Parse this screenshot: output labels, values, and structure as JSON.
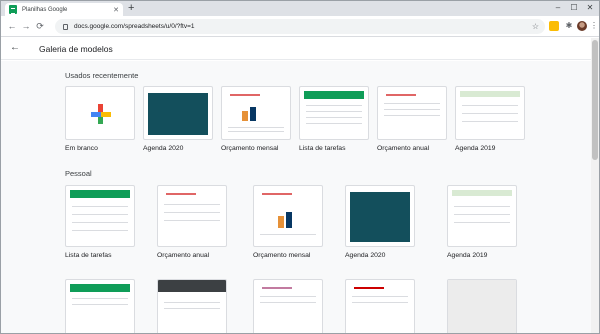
{
  "browser": {
    "tab_title": "Planilhas Google",
    "url": "docs.google.com/spreadsheets/u/0/?ftv=1"
  },
  "header": {
    "title": "Galeria de modelos"
  },
  "sections": {
    "recent": {
      "title": "Usados recentemente",
      "items": [
        "Em branco",
        "Agenda 2020",
        "Orçamento mensal",
        "Lista de tarefas",
        "Orçamento anual",
        "Agenda 2019"
      ]
    },
    "personal": {
      "title": "Pessoal",
      "items": [
        "Lista de tarefas",
        "Orçamento anual",
        "Orçamento mensal",
        "Agenda 2020",
        "Agenda 2019"
      ]
    }
  },
  "colors": {
    "sheets_green": "#0f9d58",
    "calendar_teal": "#134f5c",
    "accent_red": "#e06666"
  }
}
